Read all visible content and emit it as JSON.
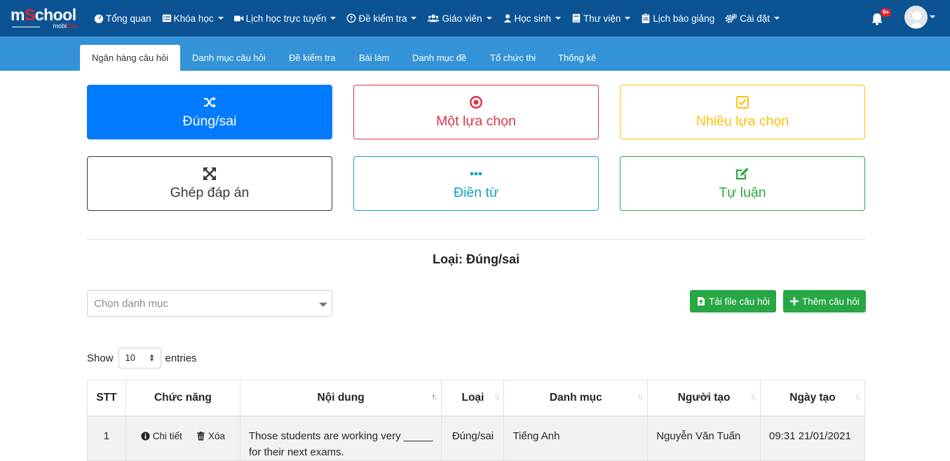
{
  "brand": {
    "logo_word": "mSchool",
    "logo_sub": "mobiEdu"
  },
  "topnav": {
    "items": [
      {
        "label": "Tổng quan",
        "icon": "dashboard-icon",
        "caret": false
      },
      {
        "label": "Khóa học",
        "icon": "list-icon",
        "caret": true
      },
      {
        "label": "Lịch học trực tuyến",
        "icon": "video-icon",
        "caret": true
      },
      {
        "label": "Đề kiểm tra",
        "icon": "question-circle-icon",
        "caret": true
      },
      {
        "label": "Giáo viên",
        "icon": "users-icon",
        "caret": true
      },
      {
        "label": "Học sinh",
        "icon": "user-icon",
        "caret": true
      },
      {
        "label": "Thư viện",
        "icon": "book-icon",
        "caret": true
      },
      {
        "label": "Lịch báo giảng",
        "icon": "clipboard-icon",
        "caret": false
      },
      {
        "label": "Cài đặt",
        "icon": "cogs-icon",
        "caret": true
      }
    ],
    "notification_badge": "9+"
  },
  "subnav": {
    "tabs": [
      {
        "label": "Ngân hàng câu hỏi",
        "active": true
      },
      {
        "label": "Danh mục câu hỏi",
        "active": false
      },
      {
        "label": "Đề kiểm tra",
        "active": false
      },
      {
        "label": "Bài làm",
        "active": false
      },
      {
        "label": "Danh mục đề",
        "active": false
      },
      {
        "label": "Tổ chức thi",
        "active": false
      },
      {
        "label": "Thống kê",
        "active": false
      }
    ]
  },
  "question_types": [
    {
      "label": "Đúng/sai",
      "icon": "random-icon",
      "color": "#007bff",
      "filled": true
    },
    {
      "label": "Một lựa chọn",
      "icon": "dot-circle-icon",
      "color": "#dc3545",
      "filled": false
    },
    {
      "label": "Nhiều lựa chọn",
      "icon": "check-square-icon",
      "color": "#ffc107",
      "filled": false
    },
    {
      "label": "Ghép đáp án",
      "icon": "expand-arrows-icon",
      "color": "#343a40",
      "filled": false
    },
    {
      "label": "Điền từ",
      "icon": "ellipsis-icon",
      "color": "#17a2b8",
      "filled": false
    },
    {
      "label": "Tự luận",
      "icon": "edit-icon",
      "color": "#28a745",
      "filled": false
    }
  ],
  "current_type": "Loại: Đúng/sai",
  "category_select": {
    "placeholder": "Chọn danh mục"
  },
  "actions": {
    "upload": "Tải file câu hỏi",
    "add": "Thêm câu hỏi"
  },
  "entries": {
    "show": "Show",
    "value": "10",
    "suffix": "entries"
  },
  "table": {
    "headers": [
      "STT",
      "Chức năng",
      "Nội dung",
      "Loại",
      "Danh mục",
      "Người tạo",
      "Ngày tạo"
    ],
    "row_actions": {
      "detail": "Chi tiết",
      "delete": "Xóa"
    },
    "rows": [
      {
        "stt": "1",
        "content": "Those students are working very _____ for their next exams.",
        "type": "Đúng/sai",
        "category": "Tiếng Anh",
        "creator": "Nguyễn Văn Tuấn",
        "created": "09:31 21/01/2021"
      }
    ]
  }
}
